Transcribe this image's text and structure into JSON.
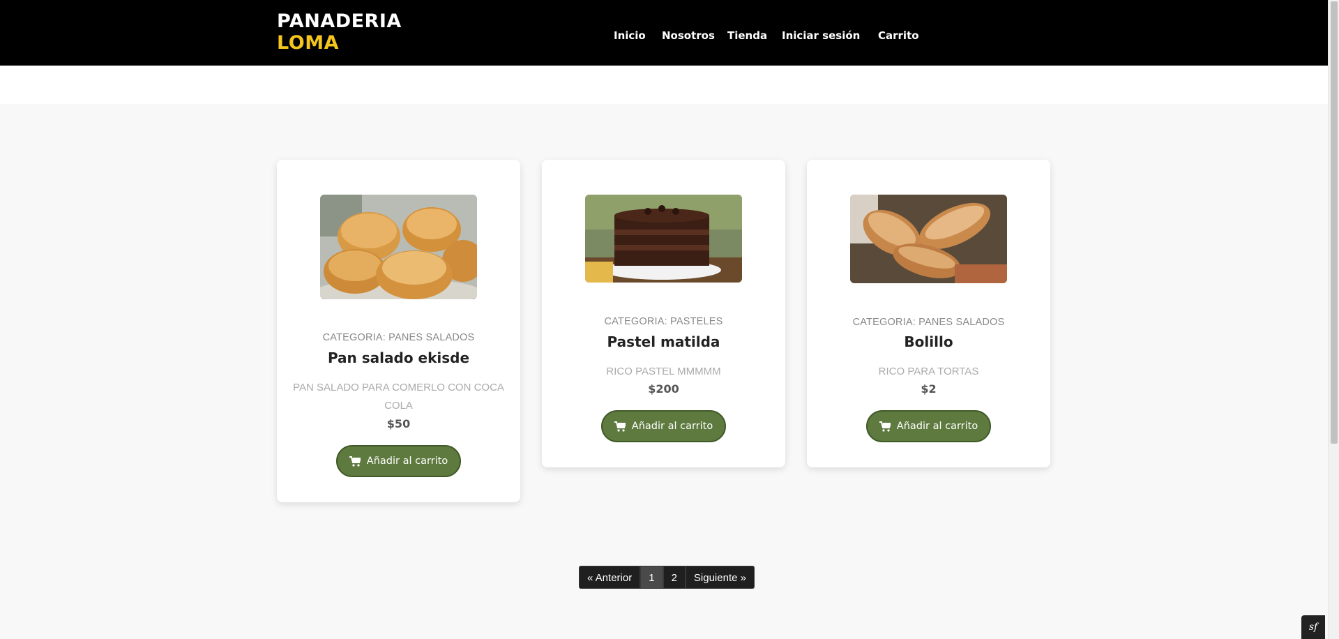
{
  "brand": {
    "line1": "PANADERIA",
    "line2": "LOMA"
  },
  "nav": {
    "items": [
      {
        "label": "Inicio"
      },
      {
        "label": "Nosotros"
      },
      {
        "label": "Tienda"
      },
      {
        "label": "Iniciar sesión"
      },
      {
        "label": "Carrito"
      }
    ]
  },
  "products": [
    {
      "image": "bread-buns-image",
      "category": "CATEGORIA: PANES SALADOS",
      "name": "Pan salado ekisde",
      "description": "PAN SALADO PARA COMERLO CON COCA COLA",
      "price": "$50",
      "button": "Añadir al carrito"
    },
    {
      "image": "chocolate-cake-image",
      "category": "CATEGORIA: PASTELES",
      "name": "Pastel matilda",
      "description": "RICO PASTEL MMMMM",
      "price": "$200",
      "button": "Añadir al carrito"
    },
    {
      "image": "bolillo-image",
      "category": "CATEGORIA: PANES SALADOS",
      "name": "Bolillo",
      "description": "RICO PARA TORTAS",
      "price": "$2",
      "button": "Añadir al carrito"
    }
  ],
  "pagination": {
    "prev": "« Anterior",
    "pages": [
      "1",
      "2"
    ],
    "current": "1",
    "next": "Siguiente »"
  },
  "debug_badge": "sf",
  "colors": {
    "header_bg": "#000000",
    "brand_accent": "#f4c51b",
    "button_bg": "#5e7a3f",
    "page_bg": "#f8f8f8"
  }
}
